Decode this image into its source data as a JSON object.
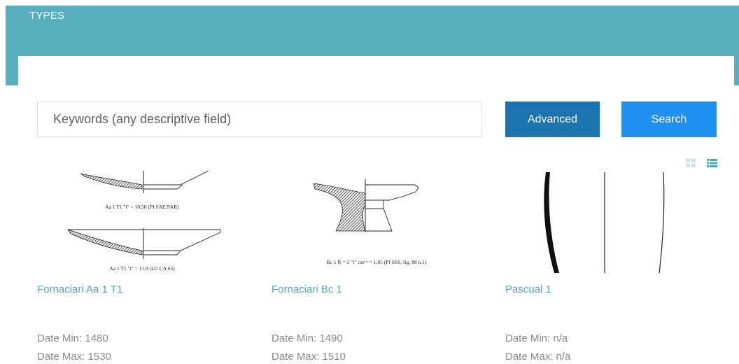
{
  "header": {
    "title": "TYPES"
  },
  "search": {
    "placeholder": "Keywords (any descriptive field)",
    "advanced_label": "Advanced",
    "search_label": "Search"
  },
  "view_toggle": {
    "grid_icon": "grid-view-icon",
    "list_icon": "list-view-icon"
  },
  "cards": [
    {
      "title": "Fornaciari Aa 1 T1",
      "captions": [
        "Aa 1 T1 \"i\" = 10,56 (PI SAE/SAR)",
        "Aa 1 T1 \"i\" = 11,9 (LU CA 65)"
      ],
      "date_min": "Date Min: 1480",
      "date_max": "Date Max: 1530"
    },
    {
      "title": "Fornaciari Bc 1",
      "captions": [
        "Bc 1 R = 2 \"i\" cav= = 1,85 (PI SSS, fig. 88 n.1)"
      ],
      "date_min": "Date Min: 1490",
      "date_max": "Date Max: 1510"
    },
    {
      "title": "Pascual 1",
      "captions": [],
      "date_min": "Date Min: n/a",
      "date_max": "Date Max: n/a"
    }
  ],
  "colors": {
    "banner": "#57aebd",
    "advanced_button": "#1b74ad",
    "search_button": "#1f8ff0",
    "link": "#52a8bb",
    "muted_text": "#8a8a8a"
  }
}
